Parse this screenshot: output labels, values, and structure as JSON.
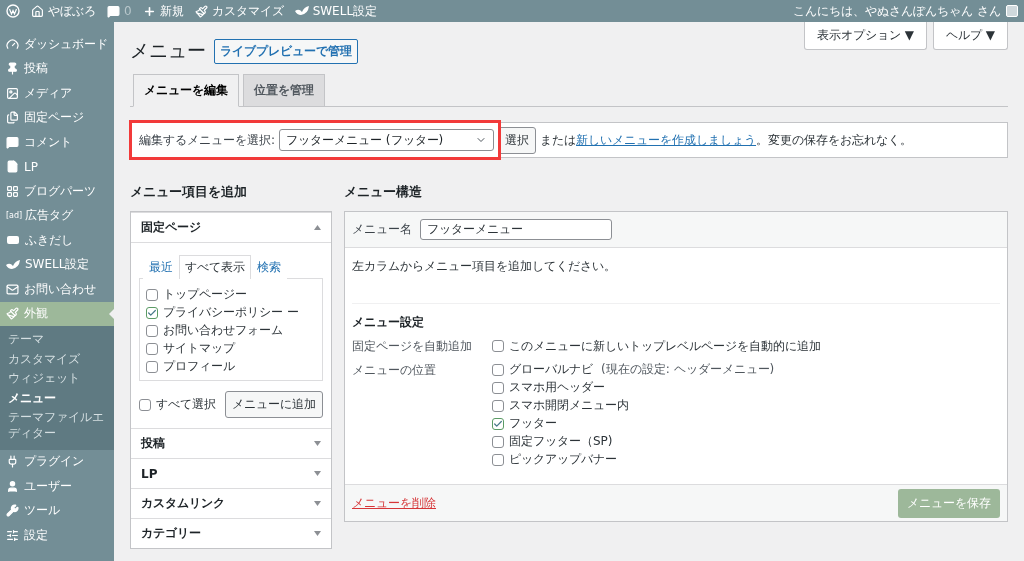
{
  "admin_bar": {
    "items": [
      {
        "kind": "wp"
      },
      {
        "kind": "home",
        "label": "やぼぶろ"
      },
      {
        "kind": "comment",
        "label": "0"
      },
      {
        "kind": "plus",
        "label": "新規"
      },
      {
        "kind": "brush",
        "label": "カスタマイズ"
      },
      {
        "kind": "bird",
        "label": "SWELL設定"
      }
    ],
    "greeting": "こんにちは、やぬさんぽんちゃん さん"
  },
  "sidebar": {
    "items": [
      {
        "kind": "gauge",
        "label": "ダッシュボード",
        "selected": false
      },
      {
        "kind": "pin",
        "label": "投稿",
        "selected": false
      },
      {
        "kind": "media",
        "label": "メディア",
        "selected": false
      },
      {
        "kind": "pages",
        "label": "固定ページ",
        "selected": false
      },
      {
        "kind": "comment",
        "label": "コメント",
        "selected": false
      },
      {
        "kind": "file",
        "label": "LP",
        "selected": false
      },
      {
        "kind": "grid",
        "label": "ブログパーツ",
        "selected": false
      },
      {
        "kind": "text",
        "icon_text": "[ad]",
        "label": "広告タグ",
        "selected": false
      },
      {
        "kind": "bubble",
        "label": "ふきだし",
        "selected": false
      },
      {
        "kind": "bird",
        "label": "SWELL設定",
        "selected": false
      },
      {
        "kind": "mail",
        "label": "お問い合わせ",
        "selected": false
      },
      {
        "kind": "brush",
        "label": "外観",
        "selected": true,
        "children": [
          {
            "label": "テーマ",
            "selected": false
          },
          {
            "label": "カスタマイズ",
            "selected": false
          },
          {
            "label": "ウィジェット",
            "selected": false
          },
          {
            "label": "メニュー",
            "selected": true
          },
          {
            "label": "テーマファイルエディター",
            "selected": false
          }
        ]
      },
      {
        "kind": "plug",
        "label": "プラグイン",
        "selected": false
      },
      {
        "kind": "user",
        "label": "ユーザー",
        "selected": false
      },
      {
        "kind": "wrench",
        "label": "ツール",
        "selected": false
      },
      {
        "kind": "settings",
        "label": "設定",
        "selected": false
      }
    ]
  },
  "header": {
    "title": "メニュー",
    "live_preview_button": "ライブプレビューで管理",
    "top_buttons": [
      "表示オプション ▼",
      "ヘルプ ▼"
    ]
  },
  "tabs": [
    {
      "label": "メニューを編集",
      "selected": true
    },
    {
      "label": "位置を管理",
      "selected": false
    }
  ],
  "menu_selector": {
    "highlighted": true,
    "label": "編集するメニューを選択:",
    "value": "フッターメニュー (フッター)",
    "button": "選択",
    "text_before": "または",
    "link": "新しいメニューを作成しましょう",
    "text_after": "。変更の保存をお忘れなく。"
  },
  "add_items": {
    "heading": "メニュー項目を追加",
    "sections": [
      {
        "title": "固定ページ",
        "expanded": true,
        "tabs": [
          {
            "label": "最近",
            "selected": false
          },
          {
            "label": "すべて表示",
            "selected": true
          },
          {
            "label": "検索",
            "selected": false
          }
        ],
        "items": [
          {
            "label": "トップページー",
            "checked": false
          },
          {
            "label": "プライバシーポリシー ー",
            "checked": true
          },
          {
            "label": "お問い合わせフォーム",
            "checked": false
          },
          {
            "label": "サイトマップ",
            "checked": false
          },
          {
            "label": "プロフィール",
            "checked": false
          }
        ],
        "select_all": {
          "label": "すべて選択",
          "checked": false
        },
        "add_button": "メニューに追加"
      },
      {
        "title": "投稿",
        "expanded": false
      },
      {
        "title": "LP",
        "expanded": false
      },
      {
        "title": "カスタムリンク",
        "expanded": false
      },
      {
        "title": "カテゴリー",
        "expanded": false
      }
    ]
  },
  "structure": {
    "heading": "メニュー構造",
    "name_label": "メニュー名",
    "name_value": "フッターメニュー",
    "instructions": "左カラムからメニュー項目を追加してください。",
    "settings_heading": "メニュー設定",
    "auto_add": {
      "label": "固定ページを自動追加",
      "option": {
        "label": "このメニューに新しいトップレベルページを自動的に追加",
        "checked": false
      }
    },
    "locations": {
      "label": "メニューの位置",
      "options": [
        {
          "label": "グローバルナビ",
          "note": "(現在の設定: ヘッダーメニュー)",
          "checked": false
        },
        {
          "label": "スマホ用ヘッダー",
          "checked": false
        },
        {
          "label": "スマホ開閉メニュー内",
          "checked": false
        },
        {
          "label": "フッター",
          "checked": true
        },
        {
          "label": "固定フッター（SP)",
          "checked": false
        },
        {
          "label": "ピックアップバナー",
          "checked": false
        }
      ]
    },
    "delete_link": "メニューを削除",
    "save_button": "メニューを保存"
  }
}
